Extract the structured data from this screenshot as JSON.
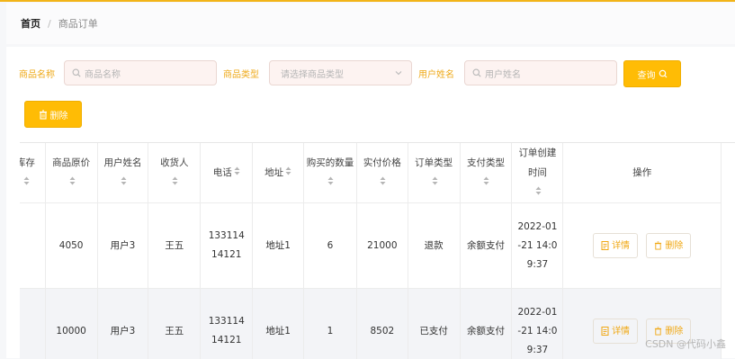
{
  "breadcrumb": {
    "home": "首页",
    "separator": "/",
    "current": "商品订单"
  },
  "search": {
    "product_name_label": "商品名称",
    "product_name_placeholder": "商品名称",
    "product_type_label": "商品类型",
    "product_type_placeholder": "请选择商品类型",
    "user_name_label": "用户姓名",
    "user_name_placeholder": "用户姓名",
    "query_button": "查询"
  },
  "toolbar": {
    "delete_button": "删除"
  },
  "table": {
    "columns": [
      "库存",
      "商品原价",
      "用户姓名",
      "收货人",
      "电话",
      "地址",
      "购买的数量",
      "实付价格",
      "订单类型",
      "支付类型",
      "订单创建时间",
      "操作"
    ],
    "rows": [
      {
        "stock": "",
        "price": "4050",
        "user": "用户3",
        "receiver": "王五",
        "phone": "13311414121",
        "address": "地址1",
        "quantity": "6",
        "paid": "21000",
        "order_type": "退款",
        "pay_type": "余额支付",
        "created": "2022-01-21 14:09:37"
      },
      {
        "stock": "",
        "price": "10000",
        "user": "用户3",
        "receiver": "王五",
        "phone": "13311414121",
        "address": "地址1",
        "quantity": "1",
        "paid": "8502",
        "order_type": "已支付",
        "pay_type": "余额支付",
        "created": "2022-01-21 14:09:37"
      }
    ],
    "actions": {
      "detail": "详情",
      "delete": "删除"
    }
  },
  "watermark": "CSDN @代码小鑫",
  "colors": {
    "accent": "#ffbc05",
    "label": "#efaa1a",
    "topline": "#f2b418"
  }
}
